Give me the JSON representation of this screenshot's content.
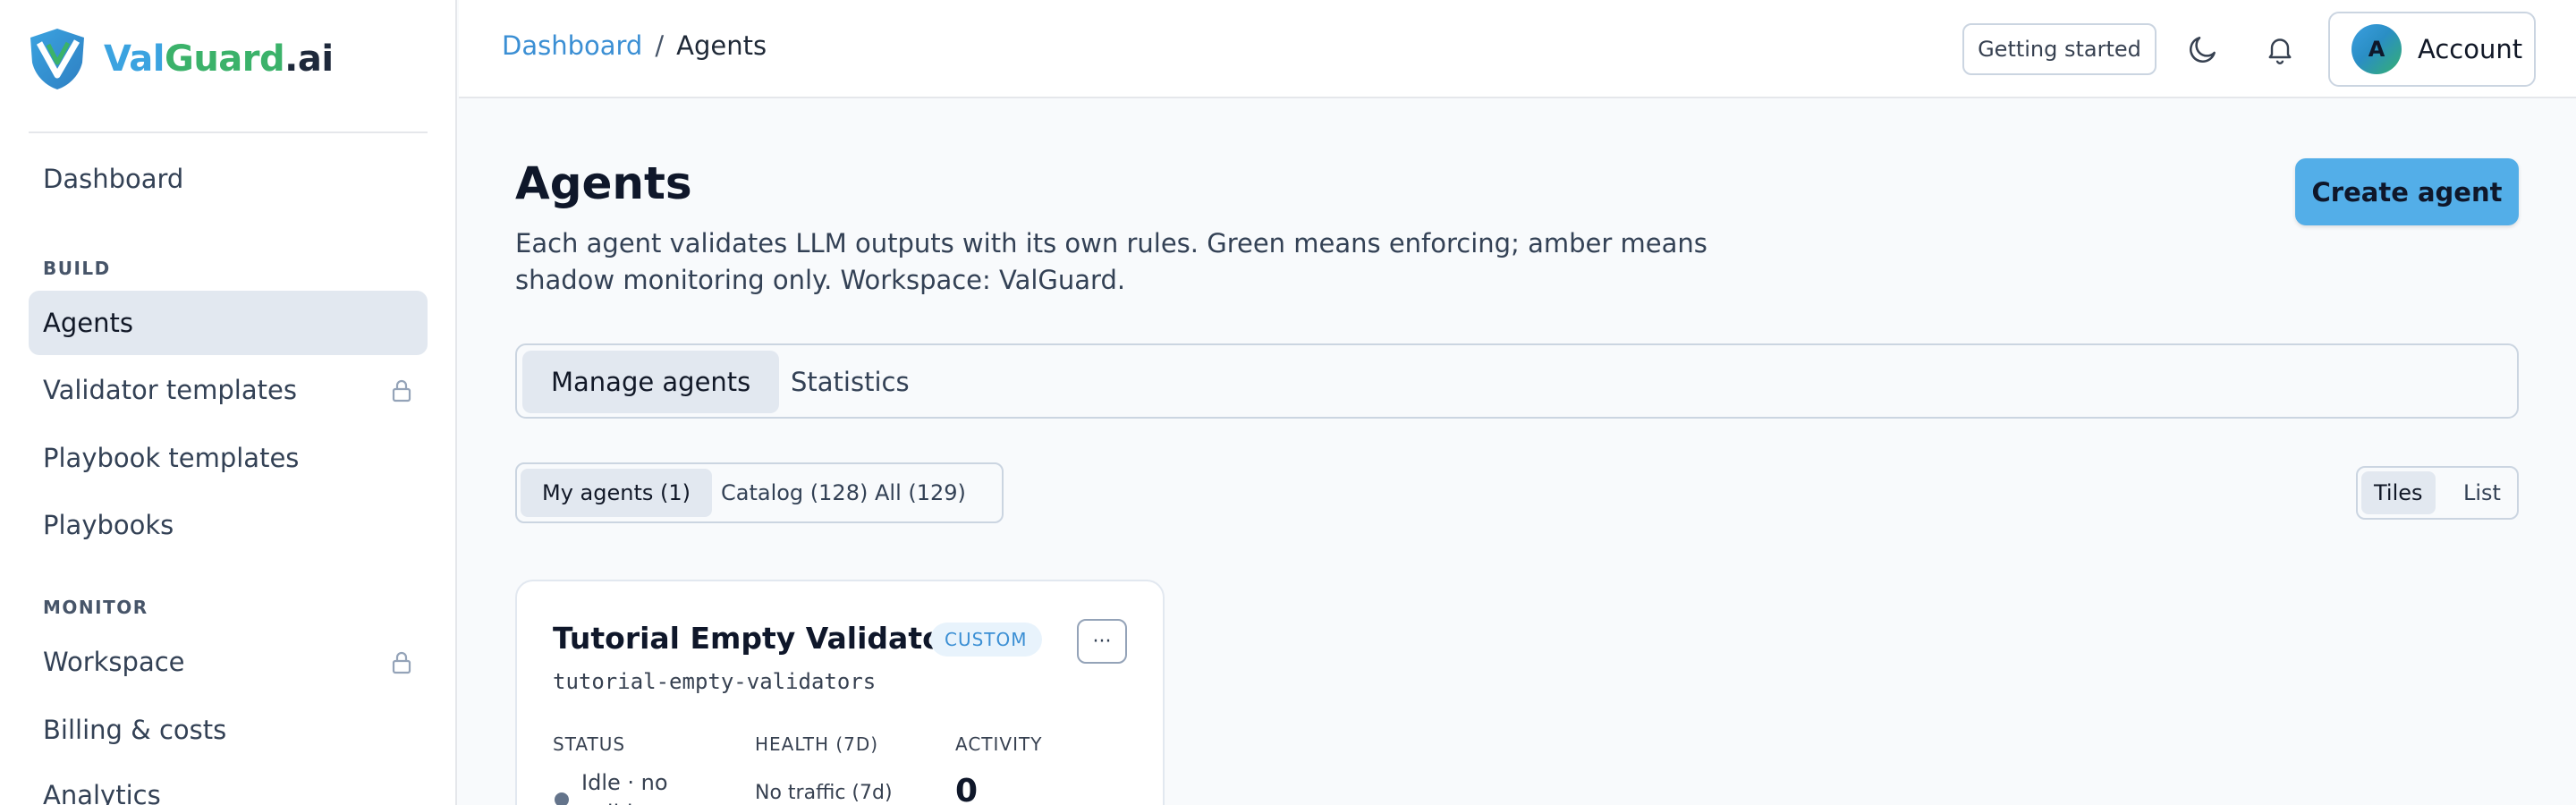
{
  "brand": {
    "val": "Val",
    "guard": "Guard",
    "ai": ".ai"
  },
  "sidebar": {
    "items": [
      {
        "label": "Dashboard"
      },
      {
        "label": "Agents"
      },
      {
        "label": "Validator templates"
      },
      {
        "label": "Playbook templates"
      },
      {
        "label": "Playbooks"
      },
      {
        "label": "Workspace"
      },
      {
        "label": "Billing & costs"
      },
      {
        "label": "Analytics"
      }
    ],
    "sections": {
      "build": "BUILD",
      "monitor": "MONITOR"
    }
  },
  "topbar": {
    "breadcrumb": {
      "root": "Dashboard",
      "sep": "/",
      "current": "Agents"
    },
    "getting_started": "Getting started",
    "avatar_initial": "A",
    "account_label": "Account"
  },
  "page": {
    "title": "Agents",
    "description": "Each agent validates LLM outputs with its own rules. Green means enforcing; amber means shadow monitoring only. Workspace: ValGuard.",
    "create_button": "Create agent"
  },
  "tabs": [
    {
      "label": "Manage agents"
    },
    {
      "label": "Statistics"
    }
  ],
  "filters": [
    {
      "label": "My agents (1)"
    },
    {
      "label": "Catalog (128)"
    },
    {
      "label": "All (129)"
    }
  ],
  "view_toggle": {
    "tiles": "Tiles",
    "list": "List"
  },
  "agent_card": {
    "title": "Tutorial Empty Validators",
    "badge": "CUSTOM",
    "menu": "···",
    "slug": "tutorial-empty-validators",
    "status_label": "STATUS",
    "health_label": "HEALTH (7D)",
    "activity_label": "ACTIVITY",
    "status_value": "Idle · no validators",
    "health_value": "No traffic (7d)",
    "activity_value": "0"
  },
  "colors": {
    "accent": "#53aee8",
    "link": "#3b8fd4",
    "brand_green": "#3bb26a",
    "active_bg": "#e2e8f0"
  },
  "icons": [
    "valguard-shield-logo",
    "lock-icon",
    "moon-icon",
    "bell-icon"
  ]
}
